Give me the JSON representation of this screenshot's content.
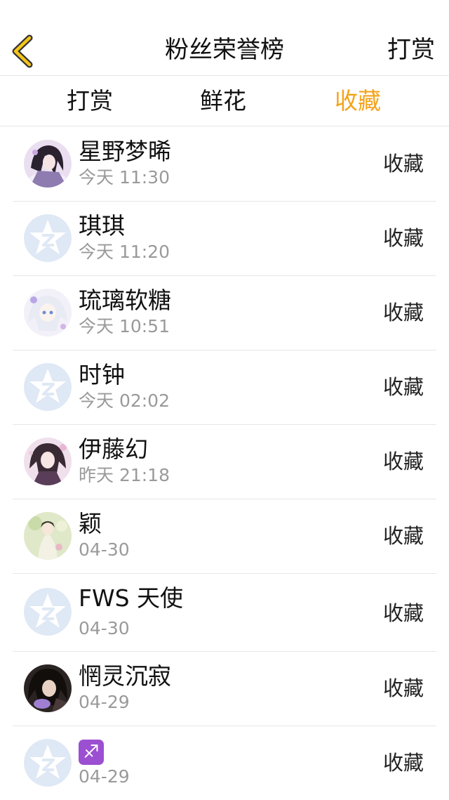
{
  "header": {
    "title": "粉丝荣誉榜",
    "action_label": "打赏"
  },
  "tabs": [
    {
      "label": "打赏",
      "active": false
    },
    {
      "label": "鲜花",
      "active": false
    },
    {
      "label": "收藏",
      "active": true
    }
  ],
  "colors": {
    "accent": "#f5a31a",
    "divider": "#e6e6e6",
    "muted_text": "#9a9a9a",
    "default_avatar": "#dfe8f5"
  },
  "fans": [
    {
      "name": "星野梦晞",
      "time": "今天 11:30",
      "action": "收藏",
      "avatar": "anime-purple-avatar"
    },
    {
      "name": "琪琪",
      "time": "今天 11:20",
      "action": "收藏",
      "avatar": "default-star-avatar"
    },
    {
      "name": "琉璃软糖",
      "time": "今天 10:51",
      "action": "收藏",
      "avatar": "anime-white-avatar"
    },
    {
      "name": "时钟",
      "time": "今天 02:02",
      "action": "收藏",
      "avatar": "default-star-avatar"
    },
    {
      "name": "伊藤幻",
      "time": "昨天 21:18",
      "action": "收藏",
      "avatar": "anime-pink-avatar"
    },
    {
      "name": "颖",
      "time": "04-30",
      "action": "收藏",
      "avatar": "anime-green-avatar"
    },
    {
      "name": "FWS 天使",
      "time": "04-30",
      "action": "收藏",
      "avatar": "default-star-avatar"
    },
    {
      "name": "惘灵沉寂",
      "time": "04-29",
      "action": "收藏",
      "avatar": "anime-dark-avatar"
    },
    {
      "name": "♐",
      "time": "04-29",
      "action": "收藏",
      "avatar": "default-star-avatar"
    }
  ]
}
